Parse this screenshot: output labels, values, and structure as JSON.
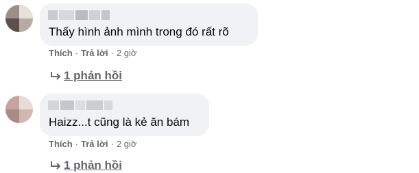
{
  "comments": [
    {
      "text": "Thấy hình ảnh mình trong đó rất rõ",
      "like_label": "Thích",
      "reply_label": "Trả lời",
      "time": "2 giờ",
      "replies_label": "1 phản hồi",
      "reply_icon": "reply-arrow-icon"
    },
    {
      "text": "Haizz...t cũng là kẻ ăn bám",
      "like_label": "Thích",
      "reply_label": "Trả lời",
      "time": "2 giờ",
      "replies_label": "1 phản hồi",
      "reply_icon": "reply-arrow-icon"
    }
  ],
  "colors": {
    "bubble_bg": "#f0f2f5",
    "secondary_text": "#65676b",
    "primary_text": "#050505"
  }
}
